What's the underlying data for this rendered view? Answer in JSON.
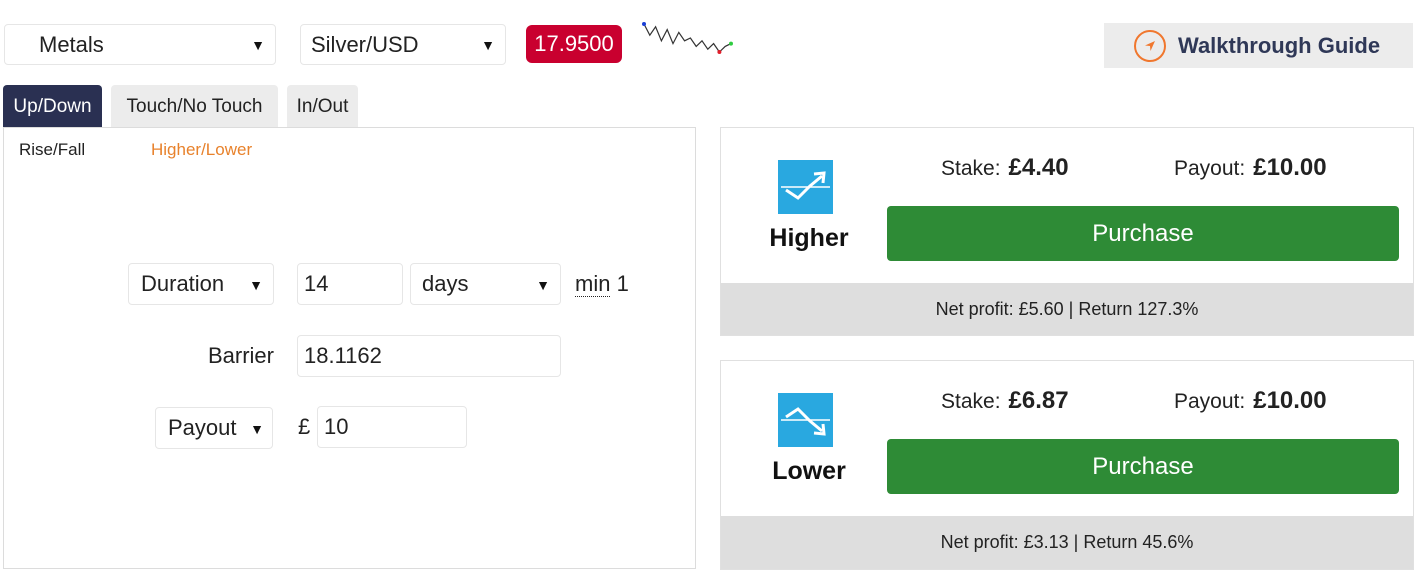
{
  "market": {
    "selected": "Metals"
  },
  "symbol": {
    "selected": "Silver/USD"
  },
  "price": "17.9500",
  "sparkline_points": [
    18.02,
    17.98,
    18.01,
    17.96,
    18.0,
    17.95,
    17.99,
    17.96,
    17.97,
    17.94,
    17.96,
    17.93,
    17.95,
    17.92,
    17.94,
    17.95
  ],
  "colors": {
    "accent": "#f0772e",
    "brand_dark": "#2a3052",
    "price_bg": "#c9002f",
    "purchase": "#2e8b36",
    "icon_bg": "#29a8e0",
    "link": "#e8822c"
  },
  "guide": {
    "label": "Walkthrough Guide",
    "icon": "compass-icon"
  },
  "tabs": [
    {
      "label": "Up/Down",
      "active": true
    },
    {
      "label": "Touch/No Touch",
      "active": false
    },
    {
      "label": "In/Out",
      "active": false
    }
  ],
  "subtabs": [
    {
      "label": "Rise/Fall",
      "active": false
    },
    {
      "label": "Higher/Lower",
      "active": true
    }
  ],
  "form": {
    "duration_select": "Duration",
    "duration_value": "14",
    "duration_unit": "days",
    "min_word": "min",
    "min_value": "1",
    "barrier_label": "Barrier",
    "barrier_value": "18.1162",
    "payout_select": "Payout",
    "currency": "£",
    "payout_value": "10"
  },
  "contracts": [
    {
      "name": "Higher",
      "icon": "trend-up-icon",
      "stake_label": "Stake:",
      "stake": "£4.40",
      "payout_label": "Payout:",
      "payout": "£10.00",
      "purchase_label": "Purchase",
      "net_profit": "Net profit: £5.60 | Return 127.3%"
    },
    {
      "name": "Lower",
      "icon": "trend-down-icon",
      "stake_label": "Stake:",
      "stake": "£6.87",
      "payout_label": "Payout:",
      "payout": "£10.00",
      "purchase_label": "Purchase",
      "net_profit": "Net profit: £3.13 | Return 45.6%"
    }
  ]
}
